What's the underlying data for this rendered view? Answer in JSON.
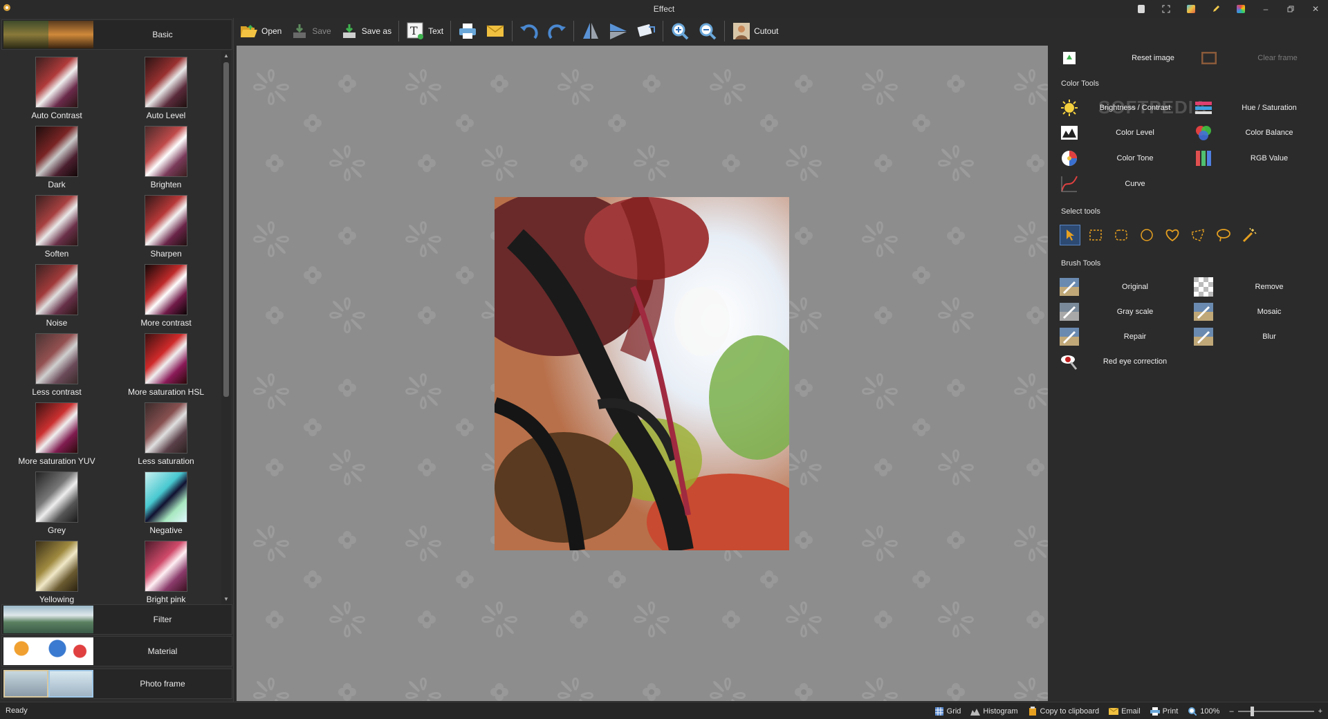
{
  "window": {
    "title": "Effect"
  },
  "toolbar": {
    "open": "Open",
    "save": "Save",
    "save_as": "Save as",
    "text": "Text",
    "cutout": "Cutout"
  },
  "left_panel": {
    "categories": {
      "basic": "Basic",
      "filter": "Filter",
      "material": "Material",
      "photo_frame": "Photo frame"
    },
    "effects": [
      "Auto Contrast",
      "Auto Level",
      "Dark",
      "Brighten",
      "Soften",
      "Sharpen",
      "Noise",
      "More contrast",
      "Less contrast",
      "More saturation HSL",
      "More saturation YUV",
      "Less saturation",
      "Grey",
      "Negative",
      "Yellowing",
      "Bright pink"
    ]
  },
  "right_panel": {
    "reset_image": "Reset image",
    "clear_frame": "Clear frame",
    "color_tools_title": "Color Tools",
    "color_tools": [
      "Brightness / Contrast",
      "Hue / Saturation",
      "Color Level",
      "Color Balance",
      "Color Tone",
      "RGB Value",
      "Curve"
    ],
    "select_tools_title": "Select tools",
    "brush_tools_title": "Brush Tools",
    "brush_tools": [
      "Original",
      "Remove",
      "Gray scale",
      "Mosaic",
      "Repair",
      "Blur",
      "Red eye correction"
    ],
    "watermark": "SOFTPEDIA"
  },
  "status_bar": {
    "ready": "Ready",
    "grid": "Grid",
    "histogram": "Histogram",
    "copy": "Copy to clipboard",
    "email": "Email",
    "print": "Print",
    "zoom": "100%",
    "minus": "–",
    "plus": "+"
  },
  "colors": {
    "accent": "#2d4a73",
    "canvas_bg": "#8d8d8d",
    "panel_bg": "#2b2b2b"
  }
}
